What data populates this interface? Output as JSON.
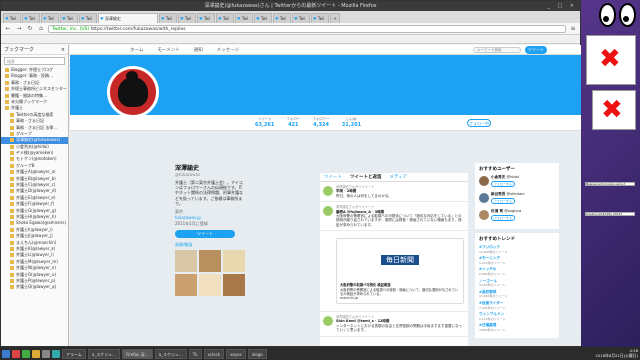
{
  "window": {
    "title": "深澤諭史(@fukazawas)さん | Twitterからの最新ツイート - Mozilla Firefox",
    "controls": "_ □ ×"
  },
  "tabs": [
    "Twi",
    "Twi",
    "Twi",
    "Twi",
    "Twi",
    "深澤諭史",
    "Twi",
    "Twi",
    "Twi",
    "Twi",
    "Twi",
    "Twi",
    "Twi",
    "Twi",
    "Twi"
  ],
  "tab_plus": "+",
  "nav": {
    "back": "←",
    "forward": "→",
    "reload": "↻",
    "home": "⌂",
    "site_identity": "Twitter, Inc. (US)",
    "url": "https://twitter.com/fukazawas/with_replies",
    "menu": "≡"
  },
  "sidebar": {
    "header": "ブックマーク",
    "close": "×",
    "search_placeholder": "検索",
    "items": [
      "Blogger: 弁理士ブログ",
      "Blogger: 事務 - 投稿…",
      "事務 - さぁ日記",
      "弁理士事務所ビジネスセンター",
      "書籍・雑誌の特集…",
      "未分類ブックマーク",
      "弁護士",
      "Twitterの高度な検索",
      "事務 - さぁ日記",
      "事務 - さぁ日記 法律…",
      "グループ",
      "深澤諭史(@fukazawas)",
      "小倉秀夫(@hidoi)",
      "ヤメ検(@yameken)",
      "モトケン(@motoken)",
      "グループB",
      "弁護士A(@lawyer_a)",
      "弁護士B(@lawyer_b)",
      "弁護士C(@lawyer_c)",
      "弁護士D(@lawyer_d)",
      "弁護士E(@lawyer_e)",
      "弁護士F(@lawyer_f)",
      "弁護士G(@lawyer_g)",
      "弁護士H(@lawyer_h)",
      "Shoko Egawa(@amneris)",
      "弁護士I(@lawyer_i)",
      "弁護士J(@lawyer_j)",
      "まえちん(@maechin)",
      "弁護士K(@lawyer_k)",
      "弁護士L(@lawyer_l)",
      "弁護士M(@lawyer_m)",
      "弁護士N(@lawyer_n)",
      "弁護士O(@lawyer_o)",
      "弁護士P(@lawyer_p)",
      "弁護士Q(@lawyer_q)"
    ],
    "selected_index": 11
  },
  "twitter_nav": {
    "home": "ホーム",
    "moments": "モーメント",
    "notifications": "通知",
    "messages": "メッセージ",
    "search_placeholder": "キーワード検索",
    "tweet_button": "ツイート"
  },
  "stats": [
    {
      "label": "ツイート",
      "value": "63,261"
    },
    {
      "label": "フォロー",
      "value": "421"
    },
    {
      "label": "フォロワー",
      "value": "4,324"
    },
    {
      "label": "いいね",
      "value": "31,201"
    }
  ],
  "follow_button": "フォロー中",
  "profile": {
    "name": "深澤諭史",
    "handle": "@fukazawas",
    "bio": "弁護士（第二東京弁護士会）。アイコンはフォロワーさんの似顔絵です。ITやネット関係の法律問題、刑事弁護などを扱っています。ご依頼は事務所まで。",
    "location": "東京",
    "url": "fukazawas.jp",
    "joined": "2011年1月に登録",
    "tweet_to": "ツイート",
    "media_header": "画像/動画"
  },
  "photo_colors": [
    "#d8c8a8",
    "#b89060",
    "#e8d8b0",
    "#caa070",
    "#f0e0c0",
    "#a87848"
  ],
  "timeline": {
    "tabs": [
      "ツイート",
      "ツイートと返信",
      "メディア"
    ],
    "active_tab": 1,
    "tweets": [
      {
        "context": "深澤諭史さんがリツイート",
        "who": "平岡 · 2時間",
        "text": "昨日、他の人は何をしてるのかな。"
      },
      {
        "context": "深澤諭史さんがリツイート",
        "who": "藤原A @fujiwara_A · 3時間",
        "text": "大阪府警の警察官による取調べの可視化について「適切な対応をしている」との説明が繰り返されていますが、実際には録音・録画されていない場面もあり、検証が求められています。"
      },
      {
        "context": "",
        "who": "",
        "text": "",
        "card": {
          "logo": "毎日新聞",
          "title": "大阪府警の取調べ可視化 検証報道",
          "desc": "大阪府警の警察官による取調べの録音・録画について、適切な運用がなされているか検証が求められている。",
          "site": "mainichi.jp"
        }
      },
      {
        "context": "深澤諭史さんがリツイート",
        "who": "Shin Kemi @kemi_s · 12時間",
        "text": "インターネットにおける表現の自由と名誉毀損の問題は今後ますます重要になっていくと思います。"
      }
    ]
  },
  "suggestions": {
    "header": "おすすめユーザー",
    "update": "更新",
    "all": "すべて見る",
    "items": [
      {
        "name": "小倉秀夫",
        "handle": "@hidoi",
        "follow": "フォローする",
        "color": "#8a6a4a"
      },
      {
        "name": "新谷秀吾",
        "handle": "@shintani",
        "follow": "フォローする",
        "color": "#5a7a9a"
      },
      {
        "name": "杉浦 司",
        "handle": "@sugiura",
        "follow": "フォローする",
        "color": "#aa8866"
      }
    ]
  },
  "trends": {
    "header": "おすすめトレンド",
    "change": "変更",
    "items": [
      {
        "tag": "#フジロック",
        "count": "12,400件のツイート"
      },
      {
        "tag": "#モーニング",
        "count": "5,210件のツイート"
      },
      {
        "tag": "#イッテQ",
        "count": "8,900件のツイート"
      },
      {
        "tag": "ノーゴール",
        "count": "3,020件のツイート"
      },
      {
        "tag": "#高校野球",
        "count": "15,600件のツイート"
      },
      {
        "tag": "#仮面ライダー",
        "count": "7,430件のツイート"
      },
      {
        "tag": "ウインブルドン",
        "count": "2,110件のツイート"
      },
      {
        "tag": "#日曜劇場",
        "count": "4,880件のツイート"
      }
    ]
  },
  "right_panel": {
    "bubble1": "Bewear-add-mysql-using-t",
    "bubble2": "birestyl-wp2016e 2016Y",
    "note_glyph": "✖"
  },
  "taskbar": {
    "tasks": [
      "アラーム",
      "a_スケジュ…",
      "Firefox 深…",
      "a_スケジュ…",
      "Tk",
      "xclock",
      "xeyes",
      "xlogo"
    ],
    "active_task": 2,
    "clock_time": "4:38",
    "clock_date": "2018年8月21日(火曜日)"
  },
  "colors": {
    "twitter_blue": "#1da1f2",
    "avatar_red": "#c62828",
    "x_red": "#e11111"
  }
}
